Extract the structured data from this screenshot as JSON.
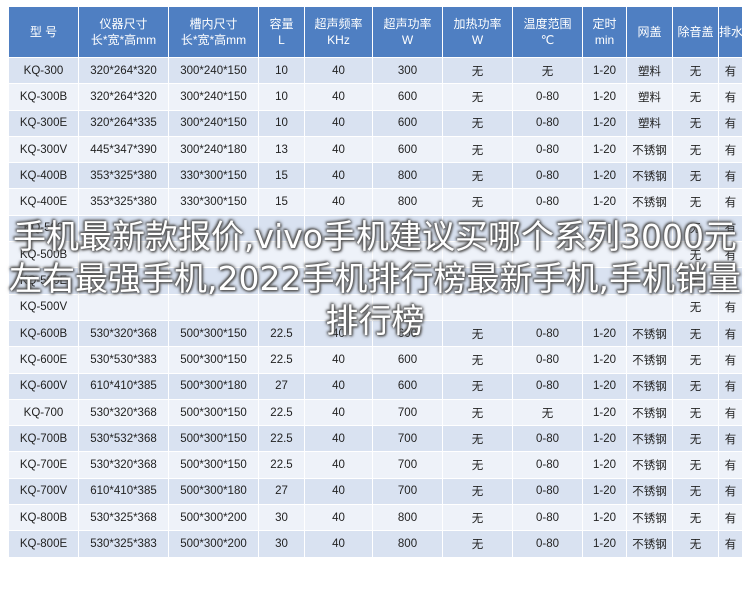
{
  "table": {
    "headers": [
      [
        "型 号",
        ""
      ],
      [
        "仪器尺寸",
        "长*宽*高mm"
      ],
      [
        "槽内尺寸",
        "长*宽*高mm"
      ],
      [
        "容量",
        "L"
      ],
      [
        "超声频率",
        "KHz"
      ],
      [
        "超声功率",
        "W"
      ],
      [
        "加热功率",
        "W"
      ],
      [
        "温度范围",
        "℃"
      ],
      [
        "定时",
        "min"
      ],
      [
        "网盖",
        ""
      ],
      [
        "除音盖",
        ""
      ],
      [
        "排水",
        ""
      ]
    ],
    "rows": [
      [
        "KQ-300",
        "320*264*320",
        "300*240*150",
        "10",
        "40",
        "300",
        "无",
        "无",
        "1-20",
        "塑料",
        "无",
        "有"
      ],
      [
        "KQ-300B",
        "320*264*320",
        "300*240*150",
        "10",
        "40",
        "600",
        "无",
        "0-80",
        "1-20",
        "塑料",
        "无",
        "有"
      ],
      [
        "KQ-300E",
        "320*264*335",
        "300*240*150",
        "10",
        "40",
        "600",
        "无",
        "0-80",
        "1-20",
        "塑料",
        "无",
        "有"
      ],
      [
        "KQ-300V",
        "445*347*390",
        "300*240*180",
        "13",
        "40",
        "600",
        "无",
        "0-80",
        "1-20",
        "不锈钢",
        "无",
        "有"
      ],
      [
        "KQ-400B",
        "353*325*380",
        "330*300*150",
        "15",
        "40",
        "800",
        "无",
        "0-80",
        "1-20",
        "不锈钢",
        "无",
        "有"
      ],
      [
        "KQ-400E",
        "353*325*380",
        "330*300*150",
        "15",
        "40",
        "800",
        "无",
        "0-80",
        "1-20",
        "不锈钢",
        "无",
        "有"
      ],
      [
        "KQ-500",
        "",
        "",
        "",
        "",
        "",
        "",
        "",
        "",
        "",
        "无",
        "有"
      ],
      [
        "KQ-500B",
        "",
        "",
        "",
        "",
        "",
        "",
        "",
        "",
        "",
        "无",
        "有"
      ],
      [
        "KQ-500E",
        "",
        "",
        "",
        "",
        "",
        "",
        "",
        "",
        "",
        "无",
        "有"
      ],
      [
        "KQ-500V",
        "",
        "",
        "",
        "",
        "",
        "",
        "",
        "",
        "",
        "无",
        "有"
      ],
      [
        "KQ-600B",
        "530*320*368",
        "500*300*150",
        "22.5",
        "40",
        "600",
        "无",
        "0-80",
        "1-20",
        "不锈钢",
        "无",
        "有"
      ],
      [
        "KQ-600E",
        "530*530*383",
        "500*300*150",
        "22.5",
        "40",
        "600",
        "无",
        "0-80",
        "1-20",
        "不锈钢",
        "无",
        "有"
      ],
      [
        "KQ-600V",
        "610*410*385",
        "500*300*180",
        "27",
        "40",
        "600",
        "无",
        "0-80",
        "1-20",
        "不锈钢",
        "无",
        "有"
      ],
      [
        "KQ-700",
        "530*320*368",
        "500*300*150",
        "22.5",
        "40",
        "700",
        "无",
        "无",
        "1-20",
        "不锈钢",
        "无",
        "有"
      ],
      [
        "KQ-700B",
        "530*532*368",
        "500*300*150",
        "22.5",
        "40",
        "700",
        "无",
        "0-80",
        "1-20",
        "不锈钢",
        "无",
        "有"
      ],
      [
        "KQ-700E",
        "530*320*368",
        "500*300*150",
        "22.5",
        "40",
        "700",
        "无",
        "0-80",
        "1-20",
        "不锈钢",
        "无",
        "有"
      ],
      [
        "KQ-700V",
        "610*410*385",
        "500*300*180",
        "27",
        "40",
        "700",
        "无",
        "0-80",
        "1-20",
        "不锈钢",
        "无",
        "有"
      ],
      [
        "KQ-800B",
        "530*325*368",
        "500*300*200",
        "30",
        "40",
        "800",
        "无",
        "0-80",
        "1-20",
        "不锈钢",
        "无",
        "有"
      ],
      [
        "KQ-800E",
        "530*325*383",
        "500*300*200",
        "30",
        "40",
        "800",
        "无",
        "0-80",
        "1-20",
        "不锈钢",
        "无",
        "有"
      ]
    ]
  },
  "overlay": {
    "title": "手机最新款报价,vivo手机建议买哪个系列3000元左右最强手机,2022手机排行榜最新手机,手机销量排行榜"
  },
  "colors": {
    "header_bg": "#4f7fc2",
    "row_dark": "#d9e2f1",
    "row_light": "#eef2f9"
  }
}
